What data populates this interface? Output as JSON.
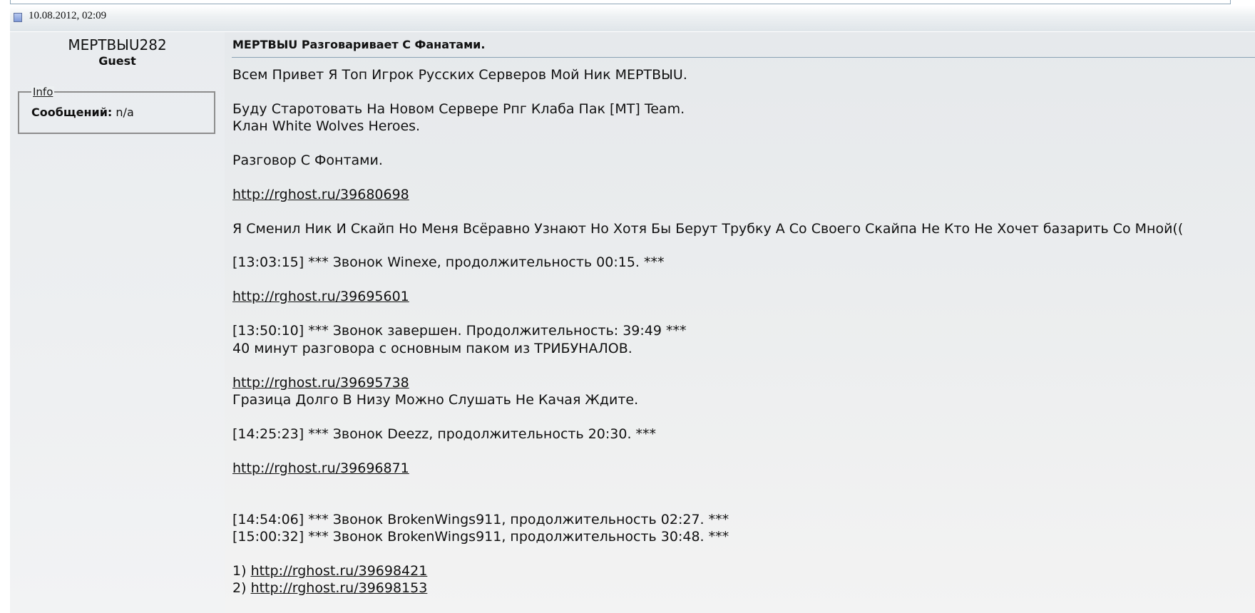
{
  "post": {
    "date": "10.08.2012, 02:09",
    "author": {
      "name": "МЕРТВЫU282",
      "title": "Guest",
      "info_legend": "Info",
      "posts_label": "Сообщений:",
      "posts_value": "n/a"
    },
    "title": "МЕРТВЫU Разговаривает С Фанатами.",
    "body": {
      "l1": "Всем Привет Я Топ Игрок Русских Серверов Мой Ник МЕРТВЫU.",
      "l2": "Буду Старотовать На Новом Сервере Рпг Клаба Пак [MT] Team.",
      "l3": "Клан White Wolves Heroes.",
      "l4": "Разговор С Фонтами.",
      "link1": "http://rghost.ru/39680698",
      "l5": "Я Сменил Ник И Скайп Но Меня Всёравно Узнают Но Хотя Бы Берут Трубку А Со Своего Скайпа Не Кто Не Хочет базарить Со Мной((",
      "l6": "[13:03:15] *** Звонок Winexe, продолжительность 00:15. ***",
      "link2": "http://rghost.ru/39695601",
      "l7": "[13:50:10] *** Звонок завершен. Продолжительность: 39:49 ***",
      "l8": "40 минут разговора с основным паком из ТРИБУНАЛОВ.",
      "link3": "http://rghost.ru/39695738",
      "l9": "Гразица Долго В Низу Можно Слушать Не Качая Ждите.",
      "l10": "[14:25:23] *** Звонок Deezz, продолжительность 20:30. ***",
      "link4": "http://rghost.ru/39696871",
      "l11": "[14:54:06] *** Звонок BrokenWings911, продолжительность 02:27. ***",
      "l12": "[15:00:32] *** Звонок BrokenWings911, продолжительность 30:48. ***",
      "n1": "1)",
      "link5": "http://rghost.ru/39698421",
      "n2": "2)",
      "link6": "http://rghost.ru/39698153"
    }
  }
}
